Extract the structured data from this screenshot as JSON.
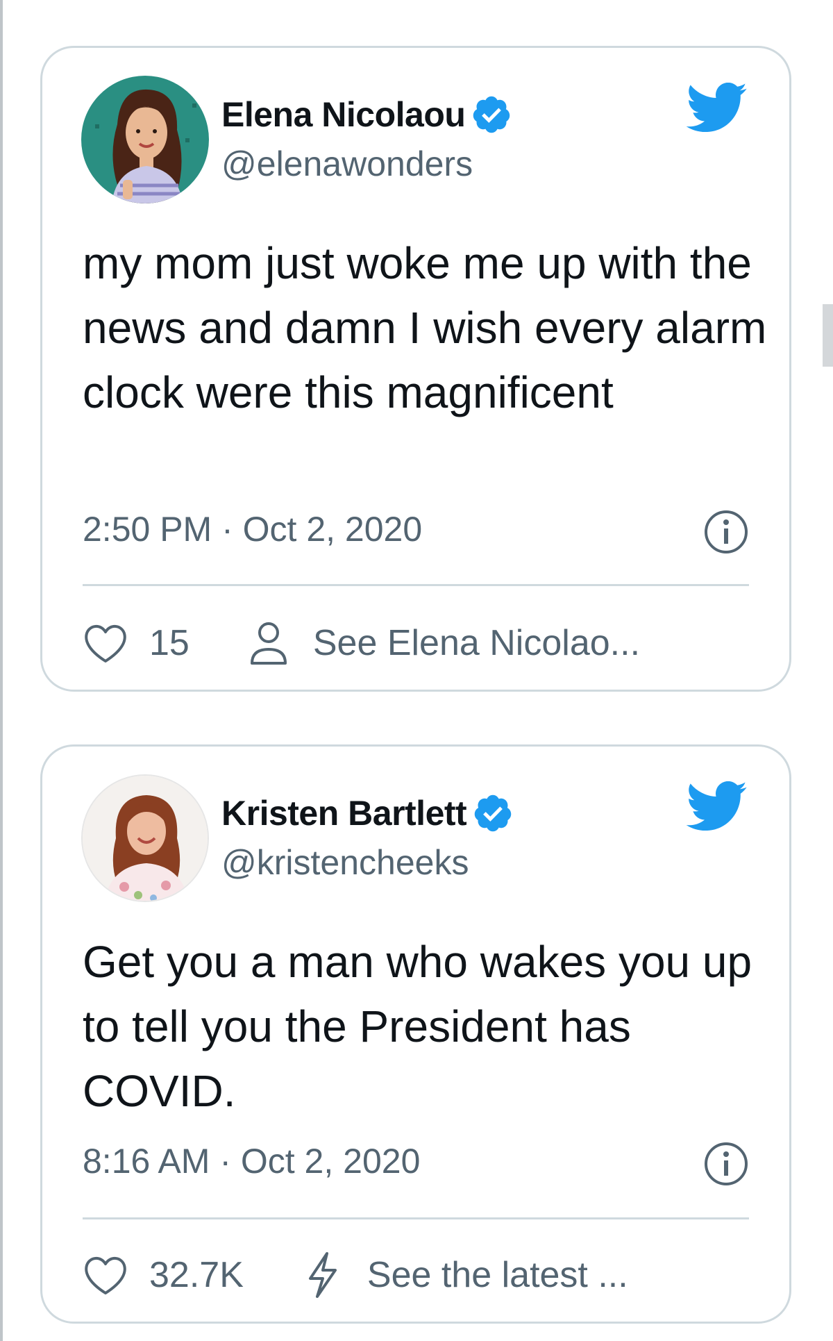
{
  "tweets": [
    {
      "name": "Elena Nicolaou",
      "handle": "@elenawonders",
      "text": "my mom just woke me up with the news and damn I wish every alarm clock were this magnificent",
      "timestamp": "2:50 PM · Oct 2, 2020",
      "likes": "15",
      "secondary_action": "See Elena Nicolao...",
      "secondary_icon": "person-icon",
      "verified": true
    },
    {
      "name": "Kristen Bartlett",
      "handle": "@kristencheeks",
      "text": "Get you a man who wakes you up to tell you the President has COVID.",
      "timestamp": "8:16 AM · Oct 2, 2020",
      "likes": "32.7K",
      "secondary_action": "See the latest ...",
      "secondary_icon": "lightning-icon",
      "verified": true
    }
  ],
  "colors": {
    "twitter_blue": "#1d9bf0",
    "secondary_text": "#536471",
    "border": "#cfd9de"
  }
}
